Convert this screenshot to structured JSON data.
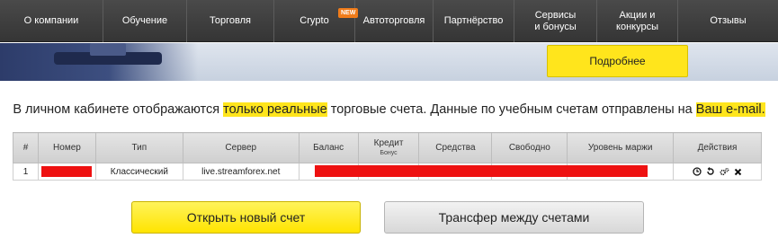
{
  "nav": {
    "items": [
      {
        "label": "О компании"
      },
      {
        "label": "Обучение"
      },
      {
        "label": "Торговля"
      },
      {
        "label": "Crypto",
        "badge": "NEW"
      },
      {
        "label": "Автоторговля"
      },
      {
        "label": "Партнёрство"
      },
      {
        "label": "Сервисы\nи бонусы"
      },
      {
        "label": "Акции и\nконкурсы"
      },
      {
        "label": "Отзывы"
      }
    ]
  },
  "banner": {
    "details_button": "Подробнее"
  },
  "info": {
    "part1": "В личном кабинете отображаются ",
    "highlight1": "только реальные",
    "part2": " торговые счета. Данные по учебным счетам отправлены на ",
    "highlight2": "Ваш e-mail."
  },
  "table": {
    "headers": {
      "num": "#",
      "number": "Номер",
      "type": "Тип",
      "server": "Сервер",
      "balance": "Баланс",
      "credit": "Кредит",
      "credit_sub": "Бонус",
      "funds": "Средства",
      "free": "Свободно",
      "margin_level": "Уровень маржи",
      "actions": "Действия"
    },
    "rows": [
      {
        "num": "1",
        "type": "Классический",
        "server": "live.streamforex.net"
      }
    ],
    "action_icons": [
      "clock-icon",
      "history-icon",
      "settings-icon",
      "close-icon"
    ]
  },
  "buttons": {
    "open_account": "Открыть новый счет",
    "transfer": "Трансфер между счетами"
  },
  "colors": {
    "accent_yellow": "#ffe51c",
    "nav_bg": "#3f3f3f",
    "redaction": "#ee1111"
  }
}
